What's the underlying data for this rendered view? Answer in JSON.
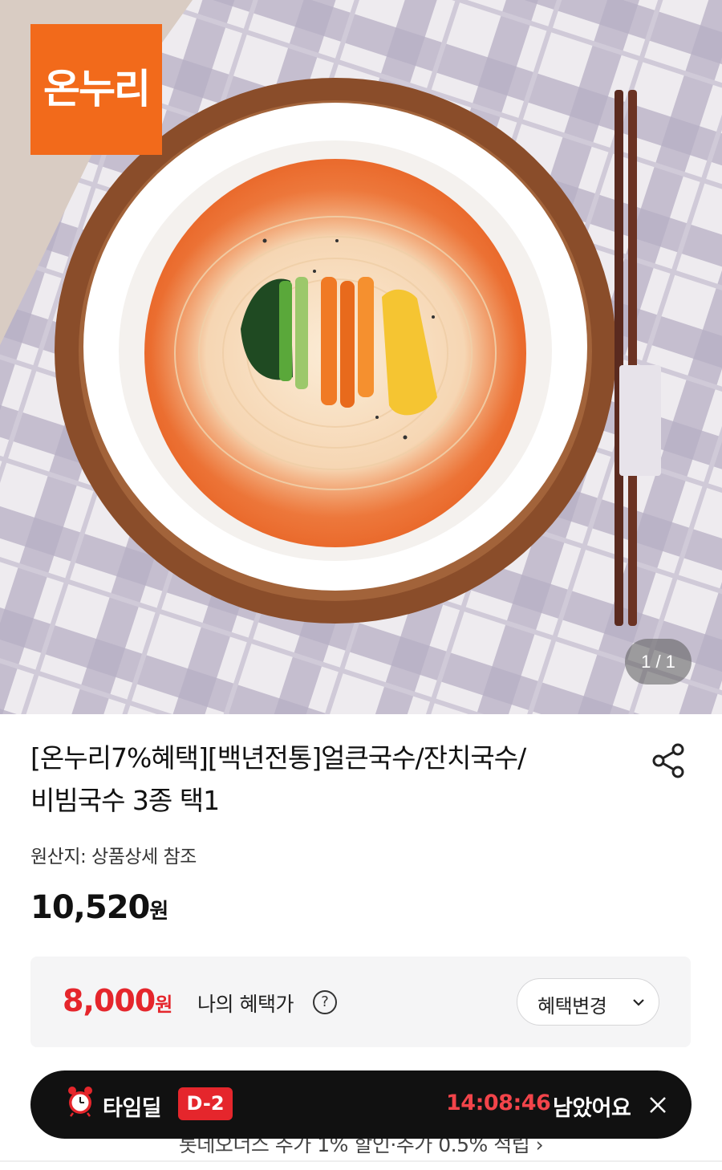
{
  "hero": {
    "logo_text": "온누리",
    "counter": "1 / 1",
    "logo_color": "#f26a1b"
  },
  "product": {
    "title_line1": "[온누리7%혜택][백년전통]얼큰국수/잔치국수/",
    "title_line2": "비빔국수 3종 택1",
    "origin": "원산지: 상품상세 참조",
    "price": "10,520",
    "price_unit": "원"
  },
  "benefit": {
    "price": "8,000",
    "price_unit": "원",
    "label": "나의 혜택가",
    "help_icon": "?",
    "change_label": "혜택변경",
    "accent": "#e5262c"
  },
  "timedeal": {
    "label": "타임딜",
    "dday": "D-2",
    "timer": "14:08:46",
    "remain": "남았어요"
  },
  "behind": {
    "text": "롯데오너스 추가 1% 할인·추가 0.5% 적립 ›"
  }
}
